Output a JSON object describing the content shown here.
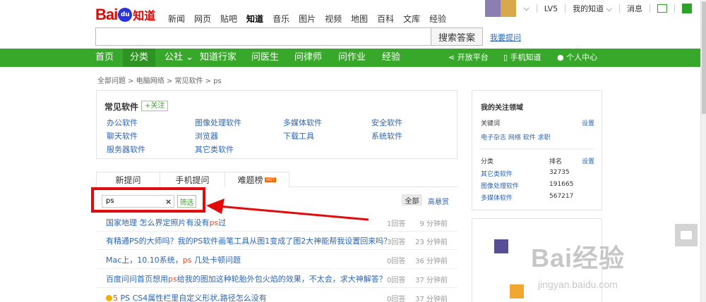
{
  "brand": {
    "logo_text": "Bai",
    "logo_paw": "du",
    "logo_suffix": "知道"
  },
  "topnav": [
    "新闻",
    "网页",
    "贴吧",
    "知道",
    "音乐",
    "图片",
    "视频",
    "地图",
    "百科",
    "文库",
    "经验"
  ],
  "topnav_active": "知道",
  "user": {
    "level": "LV5",
    "my_zhidao": "我的知道",
    "messages": "消息"
  },
  "search": {
    "button": "搜索答案",
    "ask_link": "我要提问",
    "placeholder": ""
  },
  "greennav": {
    "items": [
      "首页",
      "分类",
      "公社",
      "知道行家",
      "问医生",
      "问律师",
      "问作业",
      "经验"
    ],
    "right": [
      "开放平台",
      "手机知道",
      "个人中心"
    ]
  },
  "breadcrumb": "全部问题 > 电脑网络 > 常见软件 > ps",
  "category": {
    "title": "常见软件",
    "follow": "+关注",
    "items": [
      "办公软件",
      "图像处理软件",
      "多媒体软件",
      "安全软件",
      "聊天软件",
      "浏览器",
      "下载工具",
      "系统软件",
      "服务器软件",
      "其它类软件"
    ]
  },
  "tabs": [
    "新提问",
    "手机提问",
    "难题榜"
  ],
  "hot_badge": "HOT",
  "filter": {
    "value": "ps",
    "clear": "×",
    "button": "筛选",
    "all": "全部",
    "reward": "高悬赏"
  },
  "questions": [
    {
      "pre": "国家地理 怎么界定照片有没有",
      "hl": "ps",
      "post": "过",
      "coin": "",
      "answers": "1回答",
      "time": "9 分钟前"
    },
    {
      "pre": "有精通PS的大师吗？我的PS软件画笔工具从图1变成了图2大神能帮我设置回来吗？",
      "hl": "",
      "post": "",
      "coin": "",
      "answers": "3回答",
      "time": "23 分钟前"
    },
    {
      "pre": "Mac上，10.10系统，",
      "hl": "ps",
      "post": " 几处卡顿问题",
      "coin": "",
      "answers": "0回答",
      "time": "36 分钟前"
    },
    {
      "pre": "百度问问首页想用",
      "hl": "ps",
      "post": "给我的图加这种轮胎外包火焰的效果，不太会，求大神解答？",
      "coin": "",
      "answers": "0回答",
      "time": "37 分钟前"
    },
    {
      "pre": "PS CS4属性栏里自定义形状,路径怎么没有",
      "hl": "",
      "post": "",
      "coin": "5",
      "answers": "0回答",
      "time": "37 分钟前"
    }
  ],
  "rightpanel": {
    "title": "我的关注领域",
    "keywords_label": "关键词",
    "settings": "设置",
    "keywords": "电子杂志  网络 软件  求职",
    "cat_header": "分类",
    "rank_header": "排名",
    "rows": [
      {
        "name": "其它类软件",
        "rank": "32735"
      },
      {
        "name": "图像处理软件",
        "rank": "191665"
      },
      {
        "name": "多媒体软件",
        "rank": "567217"
      }
    ]
  },
  "watermark": {
    "text": "Bai经验",
    "url": "jingyan.baidu.com"
  },
  "colors": {
    "brand_red": "#e10602",
    "nav_green": "#38a82a",
    "link_blue": "#2d64b3",
    "highlight": "#e24b2b",
    "frame_red": "#e20a0a"
  }
}
